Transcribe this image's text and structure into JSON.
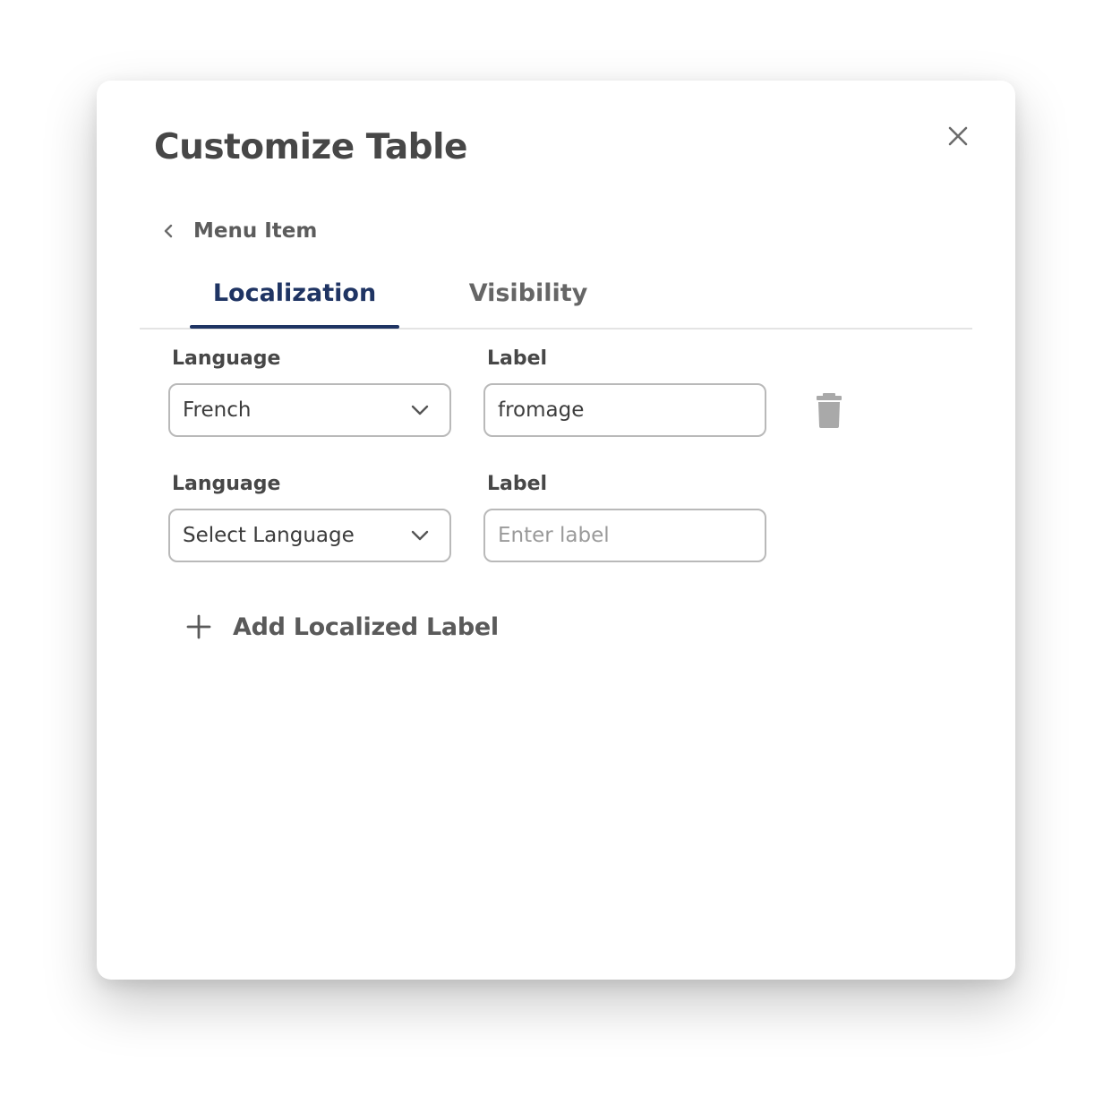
{
  "dialog": {
    "title": "Customize Table"
  },
  "breadcrumb": {
    "label": "Menu Item"
  },
  "tabs": [
    {
      "label": "Localization",
      "active": true
    },
    {
      "label": "Visibility",
      "active": false
    }
  ],
  "rows": [
    {
      "language_label": "Language",
      "language_value": "French",
      "label_label": "Label",
      "label_value": "fromage",
      "label_placeholder": ""
    },
    {
      "language_label": "Language",
      "language_value": "Select Language",
      "label_label": "Label",
      "label_value": "",
      "label_placeholder": "Enter label"
    }
  ],
  "add_button": {
    "label": "Add Localized Label"
  },
  "colors": {
    "accent": "#1f3463",
    "text": "#474747",
    "icon": "#a9a9a9",
    "border": "#b9b9b9"
  },
  "icons": {
    "close": "close-icon",
    "back": "chevron-left-icon",
    "dropdown": "chevron-down-icon",
    "delete": "trash-icon",
    "add": "plus-icon"
  }
}
